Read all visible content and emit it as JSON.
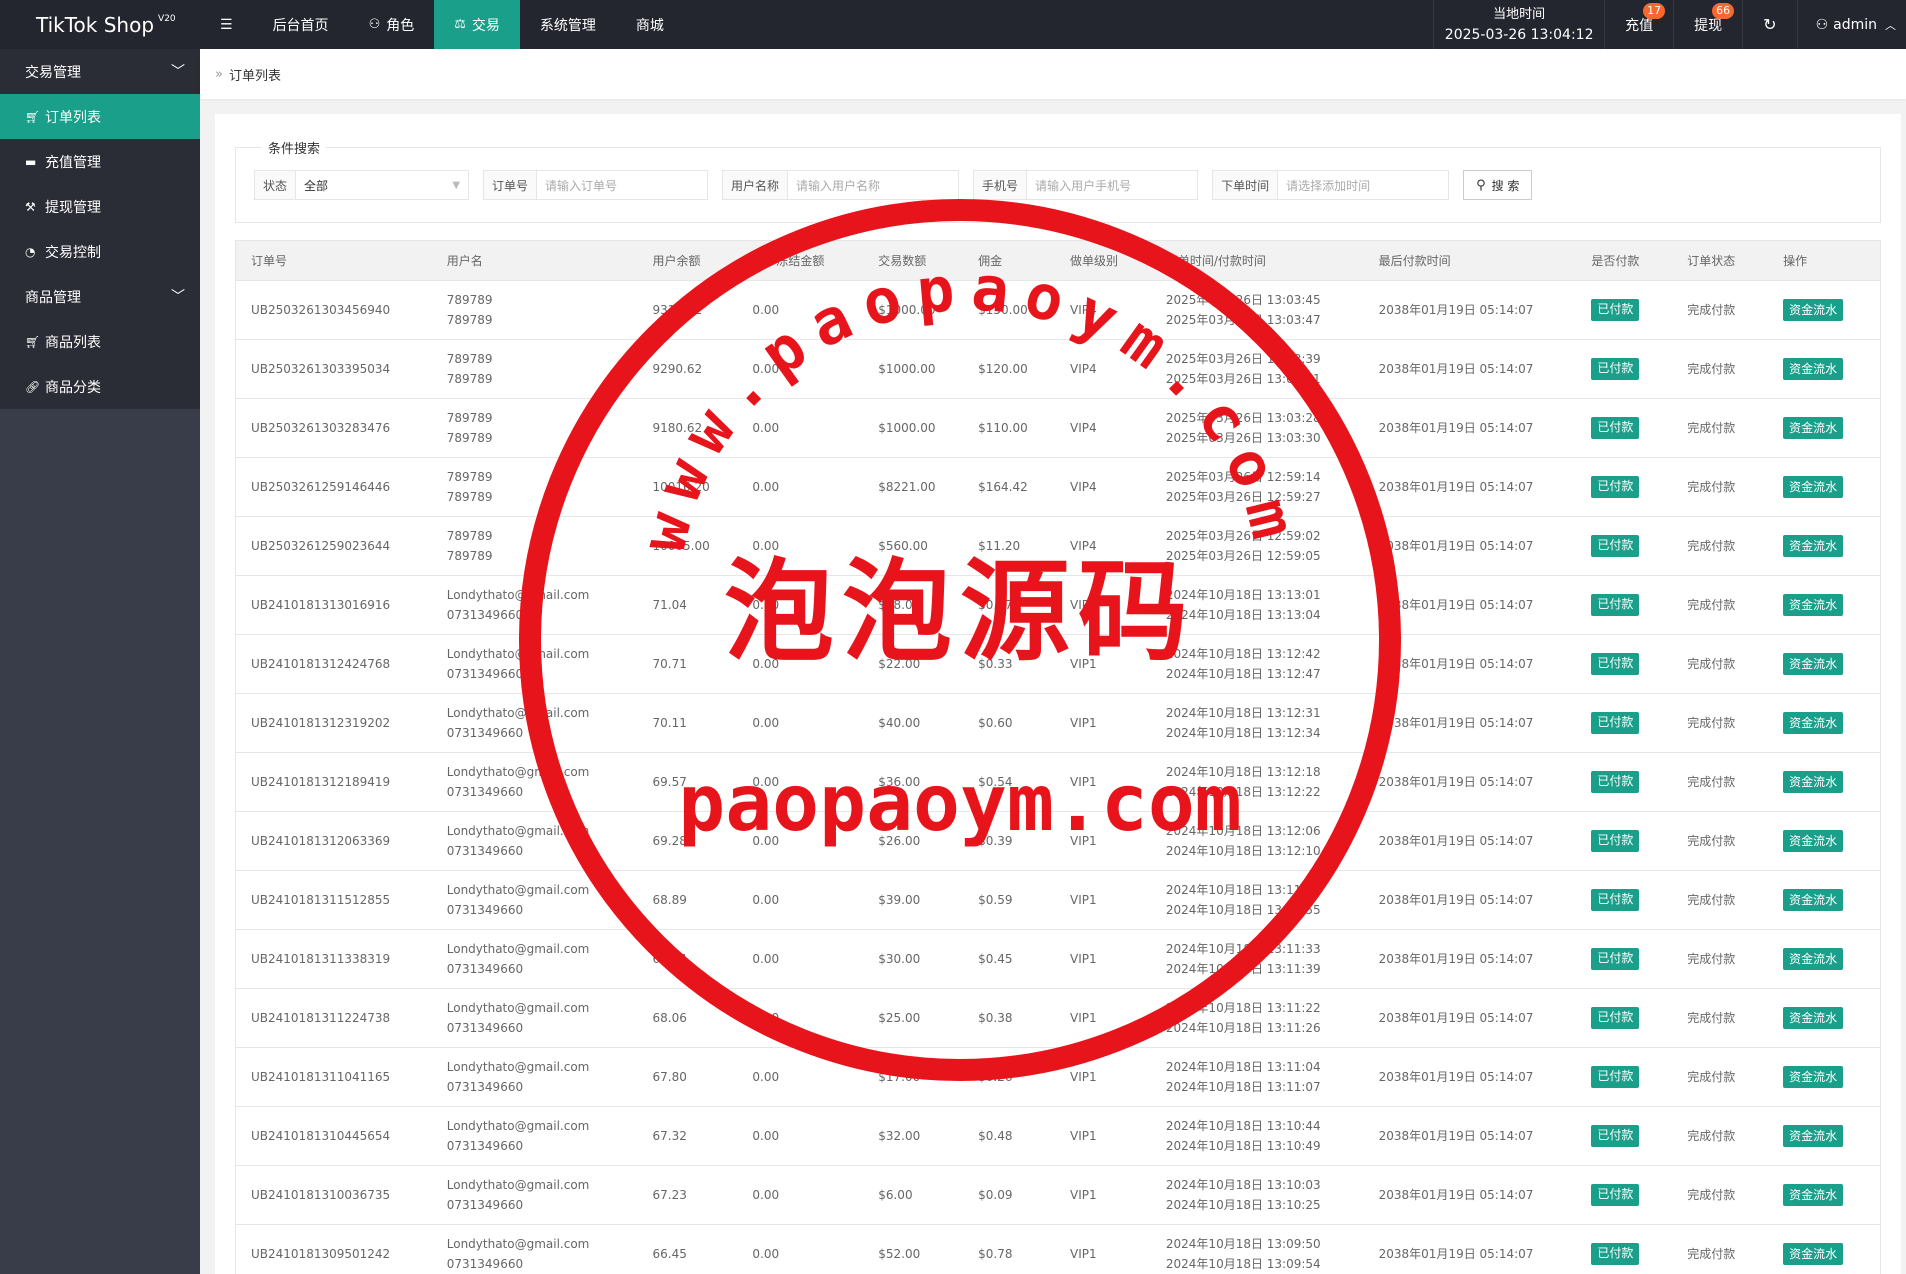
{
  "header": {
    "brand": "TikTok Shop",
    "brand_version": "V20",
    "menu_icon": "menu-icon",
    "nav": [
      {
        "label": "后台首页",
        "icon": ""
      },
      {
        "label": "角色",
        "icon": "user-icon"
      },
      {
        "label": "交易",
        "icon": "scale-icon",
        "active": true
      },
      {
        "label": "系统管理",
        "icon": ""
      },
      {
        "label": "商城",
        "icon": ""
      }
    ],
    "time_label": "当地时间",
    "time_value": "2025-03-26 13:04:12",
    "recharge_label": "充值",
    "recharge_badge": "17",
    "withdraw_label": "提现",
    "withdraw_badge": "66",
    "refresh_icon": "refresh-icon",
    "admin_label": "admin"
  },
  "sidebar": {
    "group1": "交易管理",
    "items1": [
      {
        "label": "订单列表",
        "icon": "cart-icon",
        "active": true
      },
      {
        "label": "充值管理",
        "icon": "chat-icon"
      },
      {
        "label": "提现管理",
        "icon": "hammer-icon"
      },
      {
        "label": "交易控制",
        "icon": "gauge-icon"
      }
    ],
    "group2": "商品管理",
    "items2": [
      {
        "label": "商品列表",
        "icon": "cart-icon"
      },
      {
        "label": "商品分类",
        "icon": "link-icon"
      }
    ]
  },
  "breadcrumb": {
    "current": "订单列表"
  },
  "search": {
    "legend": "条件搜索",
    "status_label": "状态",
    "status_value": "全部",
    "order_label": "订单号",
    "order_placeholder": "请输入订单号",
    "user_label": "用户名称",
    "user_placeholder": "请输入用户名称",
    "phone_label": "手机号",
    "phone_placeholder": "请输入用户手机号",
    "time_label": "下单时间",
    "time_placeholder": "请选择添加时间",
    "button": "搜 索"
  },
  "table": {
    "headers": [
      "订单号",
      "用户名",
      "用户余额",
      "用户冻结金额",
      "交易数额",
      "佣金",
      "做单级别",
      "下单时间/付款时间",
      "最后付款时间",
      "是否付款",
      "订单状态",
      "操作"
    ],
    "paid_label": "已付款",
    "status_label": "完成付款",
    "action_label": "资金流水",
    "rows": [
      {
        "id": "UB2503261303456940",
        "user1": "789789",
        "user2": "789789",
        "balance": "9310.62",
        "frozen": "0.00",
        "amount": "$1000.00",
        "commission": "$150.00",
        "level": "VIP4",
        "t1": "2025年03月26日 13:03:45",
        "t2": "2025年03月26日 13:03:47",
        "last": "2038年01月19日 05:14:07"
      },
      {
        "id": "UB2503261303395034",
        "user1": "789789",
        "user2": "789789",
        "balance": "9290.62",
        "frozen": "0.00",
        "amount": "$1000.00",
        "commission": "$120.00",
        "level": "VIP4",
        "t1": "2025年03月26日 13:03:39",
        "t2": "2025年03月26日 13:03:41",
        "last": "2038年01月19日 05:14:07"
      },
      {
        "id": "UB2503261303283476",
        "user1": "789789",
        "user2": "789789",
        "balance": "9180.62",
        "frozen": "0.00",
        "amount": "$1000.00",
        "commission": "$110.00",
        "level": "VIP4",
        "t1": "2025年03月26日 13:03:28",
        "t2": "2025年03月26日 13:03:30",
        "last": "2038年01月19日 05:14:07"
      },
      {
        "id": "UB2503261259146446",
        "user1": "789789",
        "user2": "789789",
        "balance": "10016.20",
        "frozen": "0.00",
        "amount": "$8221.00",
        "commission": "$164.42",
        "level": "VIP4",
        "t1": "2025年03月26日 12:59:14",
        "t2": "2025年03月26日 12:59:27",
        "last": "2038年01月19日 05:14:07"
      },
      {
        "id": "UB2503261259023644",
        "user1": "789789",
        "user2": "789789",
        "balance": "10005.00",
        "frozen": "0.00",
        "amount": "$560.00",
        "commission": "$11.20",
        "level": "VIP4",
        "t1": "2025年03月26日 12:59:02",
        "t2": "2025年03月26日 12:59:05",
        "last": "2038年01月19日 05:14:07"
      },
      {
        "id": "UB2410181313016916",
        "user1": "Londythato@gmail.com",
        "user2": "0731349660",
        "balance": "71.04",
        "frozen": "0.00",
        "amount": "$18.00",
        "commission": "$0.27",
        "level": "VIP1",
        "t1": "2024年10月18日 13:13:01",
        "t2": "2024年10月18日 13:13:04",
        "last": "2038年01月19日 05:14:07"
      },
      {
        "id": "UB2410181312424768",
        "user1": "Londythato@gmail.com",
        "user2": "0731349660",
        "balance": "70.71",
        "frozen": "0.00",
        "amount": "$22.00",
        "commission": "$0.33",
        "level": "VIP1",
        "t1": "2024年10月18日 13:12:42",
        "t2": "2024年10月18日 13:12:47",
        "last": "2038年01月19日 05:14:07"
      },
      {
        "id": "UB2410181312319202",
        "user1": "Londythato@gmail.com",
        "user2": "0731349660",
        "balance": "70.11",
        "frozen": "0.00",
        "amount": "$40.00",
        "commission": "$0.60",
        "level": "VIP1",
        "t1": "2024年10月18日 13:12:31",
        "t2": "2024年10月18日 13:12:34",
        "last": "2038年01月19日 05:14:07"
      },
      {
        "id": "UB2410181312189419",
        "user1": "Londythato@gmail.com",
        "user2": "0731349660",
        "balance": "69.57",
        "frozen": "0.00",
        "amount": "$36.00",
        "commission": "$0.54",
        "level": "VIP1",
        "t1": "2024年10月18日 13:12:18",
        "t2": "2024年10月18日 13:12:22",
        "last": "2038年01月19日 05:14:07"
      },
      {
        "id": "UB2410181312063369",
        "user1": "Londythato@gmail.com",
        "user2": "0731349660",
        "balance": "69.28",
        "frozen": "0.00",
        "amount": "$26.00",
        "commission": "$0.39",
        "level": "VIP1",
        "t1": "2024年10月18日 13:12:06",
        "t2": "2024年10月18日 13:12:10",
        "last": "2038年01月19日 05:14:07"
      },
      {
        "id": "UB2410181311512855",
        "user1": "Londythato@gmail.com",
        "user2": "0731349660",
        "balance": "68.89",
        "frozen": "0.00",
        "amount": "$39.00",
        "commission": "$0.59",
        "level": "VIP1",
        "t1": "2024年10月18日 13:11:51",
        "t2": "2024年10月18日 13:11:55",
        "last": "2038年01月19日 05:14:07"
      },
      {
        "id": "UB2410181311338319",
        "user1": "Londythato@gmail.com",
        "user2": "0731349660",
        "balance": "68.44",
        "frozen": "0.00",
        "amount": "$30.00",
        "commission": "$0.45",
        "level": "VIP1",
        "t1": "2024年10月18日 13:11:33",
        "t2": "2024年10月18日 13:11:39",
        "last": "2038年01月19日 05:14:07"
      },
      {
        "id": "UB2410181311224738",
        "user1": "Londythato@gmail.com",
        "user2": "0731349660",
        "balance": "68.06",
        "frozen": "0.00",
        "amount": "$25.00",
        "commission": "$0.38",
        "level": "VIP1",
        "t1": "2024年10月18日 13:11:22",
        "t2": "2024年10月18日 13:11:26",
        "last": "2038年01月19日 05:14:07"
      },
      {
        "id": "UB2410181311041165",
        "user1": "Londythato@gmail.com",
        "user2": "0731349660",
        "balance": "67.80",
        "frozen": "0.00",
        "amount": "$17.00",
        "commission": "$0.26",
        "level": "VIP1",
        "t1": "2024年10月18日 13:11:04",
        "t2": "2024年10月18日 13:11:07",
        "last": "2038年01月19日 05:14:07"
      },
      {
        "id": "UB2410181310445654",
        "user1": "Londythato@gmail.com",
        "user2": "0731349660",
        "balance": "67.32",
        "frozen": "0.00",
        "amount": "$32.00",
        "commission": "$0.48",
        "level": "VIP1",
        "t1": "2024年10月18日 13:10:44",
        "t2": "2024年10月18日 13:10:49",
        "last": "2038年01月19日 05:14:07"
      },
      {
        "id": "UB2410181310036735",
        "user1": "Londythato@gmail.com",
        "user2": "0731349660",
        "balance": "67.23",
        "frozen": "0.00",
        "amount": "$6.00",
        "commission": "$0.09",
        "level": "VIP1",
        "t1": "2024年10月18日 13:10:03",
        "t2": "2024年10月18日 13:10:25",
        "last": "2038年01月19日 05:14:07"
      },
      {
        "id": "UB2410181309501242",
        "user1": "Londythato@gmail.com",
        "user2": "0731349660",
        "balance": "66.45",
        "frozen": "0.00",
        "amount": "$52.00",
        "commission": "$0.78",
        "level": "VIP1",
        "t1": "2024年10月18日 13:09:50",
        "t2": "2024年10月18日 13:09:54",
        "last": "2038年01月19日 05:14:07"
      }
    ]
  },
  "watermark": {
    "arc_text": "www.paopaoym.com",
    "main_text": "泡泡源码",
    "sub_text": "paopaoym.com",
    "color": "#e8141b"
  }
}
